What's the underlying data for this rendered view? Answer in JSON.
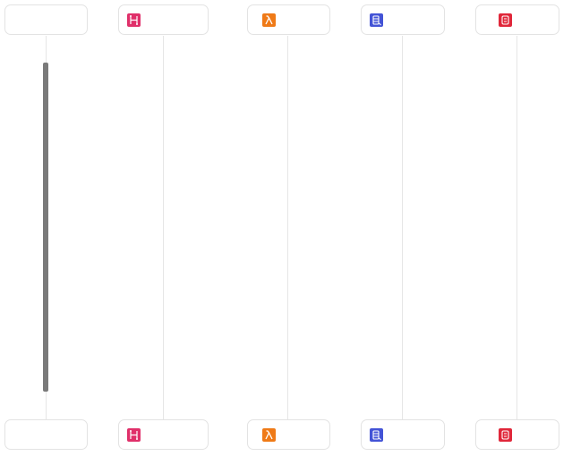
{
  "diagram": {
    "type": "sequence",
    "participants": [
      {
        "id": "p1",
        "label": "",
        "icon": null
      },
      {
        "id": "p2",
        "label": "",
        "icon": "load-balancer-icon",
        "icon_color": "#e0306a"
      },
      {
        "id": "p3",
        "label": "",
        "icon": "lambda-icon",
        "icon_color": "#ef7a17"
      },
      {
        "id": "p4",
        "label": "",
        "icon": "rds-database-icon",
        "icon_color": "#4353d6"
      },
      {
        "id": "p5",
        "label": "",
        "icon": "cache-icon",
        "icon_color": "#e0273a"
      }
    ],
    "activation": {
      "participant": "p1"
    }
  }
}
